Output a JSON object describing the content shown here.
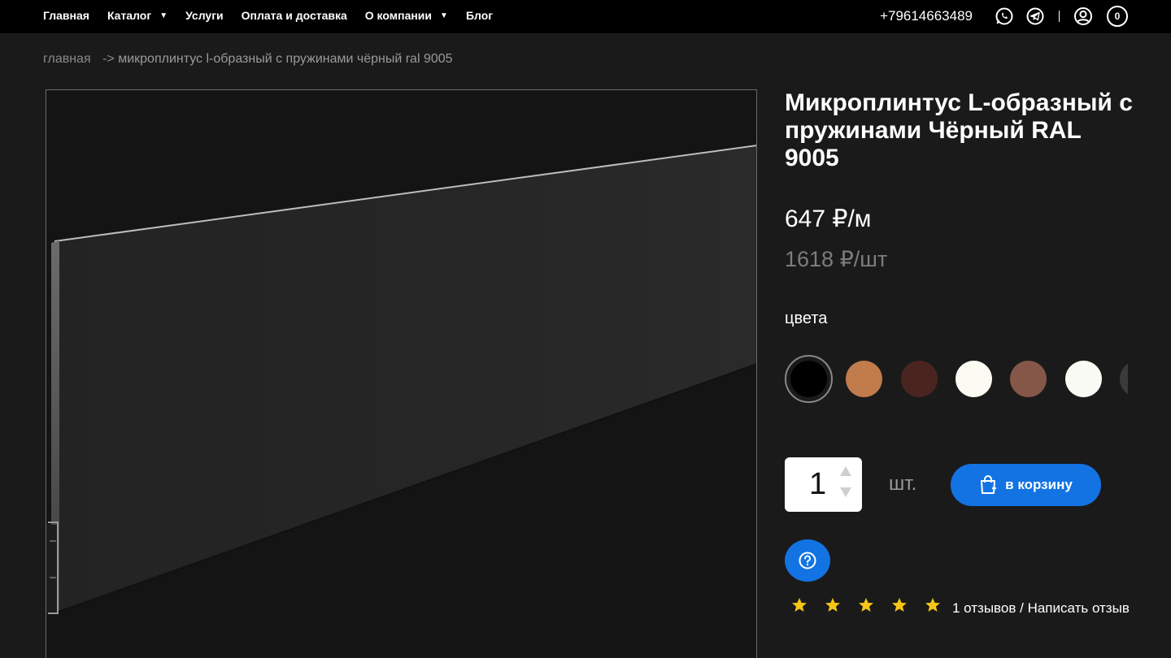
{
  "nav": {
    "items": [
      {
        "label": "Главная",
        "dropdown": false
      },
      {
        "label": "Каталог",
        "dropdown": true
      },
      {
        "label": "Услуги",
        "dropdown": false
      },
      {
        "label": "Оплата и доставка",
        "dropdown": false
      },
      {
        "label": "О компании",
        "dropdown": true
      },
      {
        "label": "Блог",
        "dropdown": false
      }
    ],
    "phone": "+79614663489",
    "icons": [
      "whatsapp-icon",
      "telegram-icon",
      "user-icon"
    ],
    "cart_count": "0"
  },
  "breadcrumb": {
    "home": "главная",
    "separator": "->",
    "current": "микроплинтус l-образный с пружинами чёрный ral 9005"
  },
  "product": {
    "title": "Микроплинтус L-образный с пружинами Чёрный RAL 9005",
    "price": "647 ₽/м",
    "price_per_piece": "1618 ₽/шт",
    "colors_label": "цвета",
    "colors": [
      "#000000",
      "#c27c4c",
      "#4a2520",
      "#fbfbf4",
      "#855748",
      "#fafaf4",
      "#3a3a3a"
    ],
    "selected_color_index": 0,
    "quantity": "1",
    "unit": "шт.",
    "add_to_cart": "в корзину",
    "rating_stars": 5,
    "reviews_count": "1 отзывов",
    "reviews_separator": " / ",
    "write_review": "Написать отзыв"
  },
  "colors": {
    "accent": "#1373e3",
    "background": "#1a1a1a",
    "topbar": "#000000",
    "star": "#f5c518"
  }
}
